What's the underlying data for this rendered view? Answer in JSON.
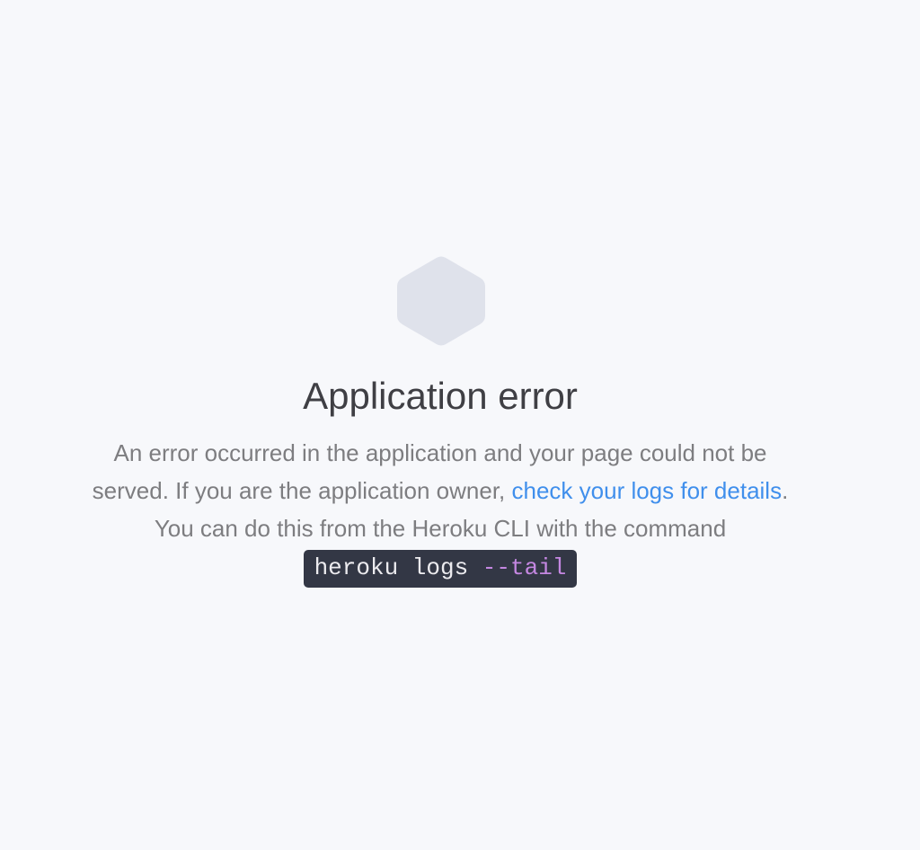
{
  "title": "Application error",
  "message": {
    "line1": "An error occurred in the application and your page could not be",
    "line2_prefix": "served. If you are the application owner, ",
    "link_text": "check your logs for details",
    "line2_suffix": ".",
    "line3": "You can do this from the Heroku CLI with the command"
  },
  "command": {
    "base": "heroku logs ",
    "flag": "--tail"
  },
  "colors": {
    "background": "#f7f8fb",
    "hexagon": "#dfe2eb",
    "link": "#408fec",
    "command_bg": "#333745",
    "command_flag": "#c487e1"
  },
  "icon": "hexagon-icon"
}
